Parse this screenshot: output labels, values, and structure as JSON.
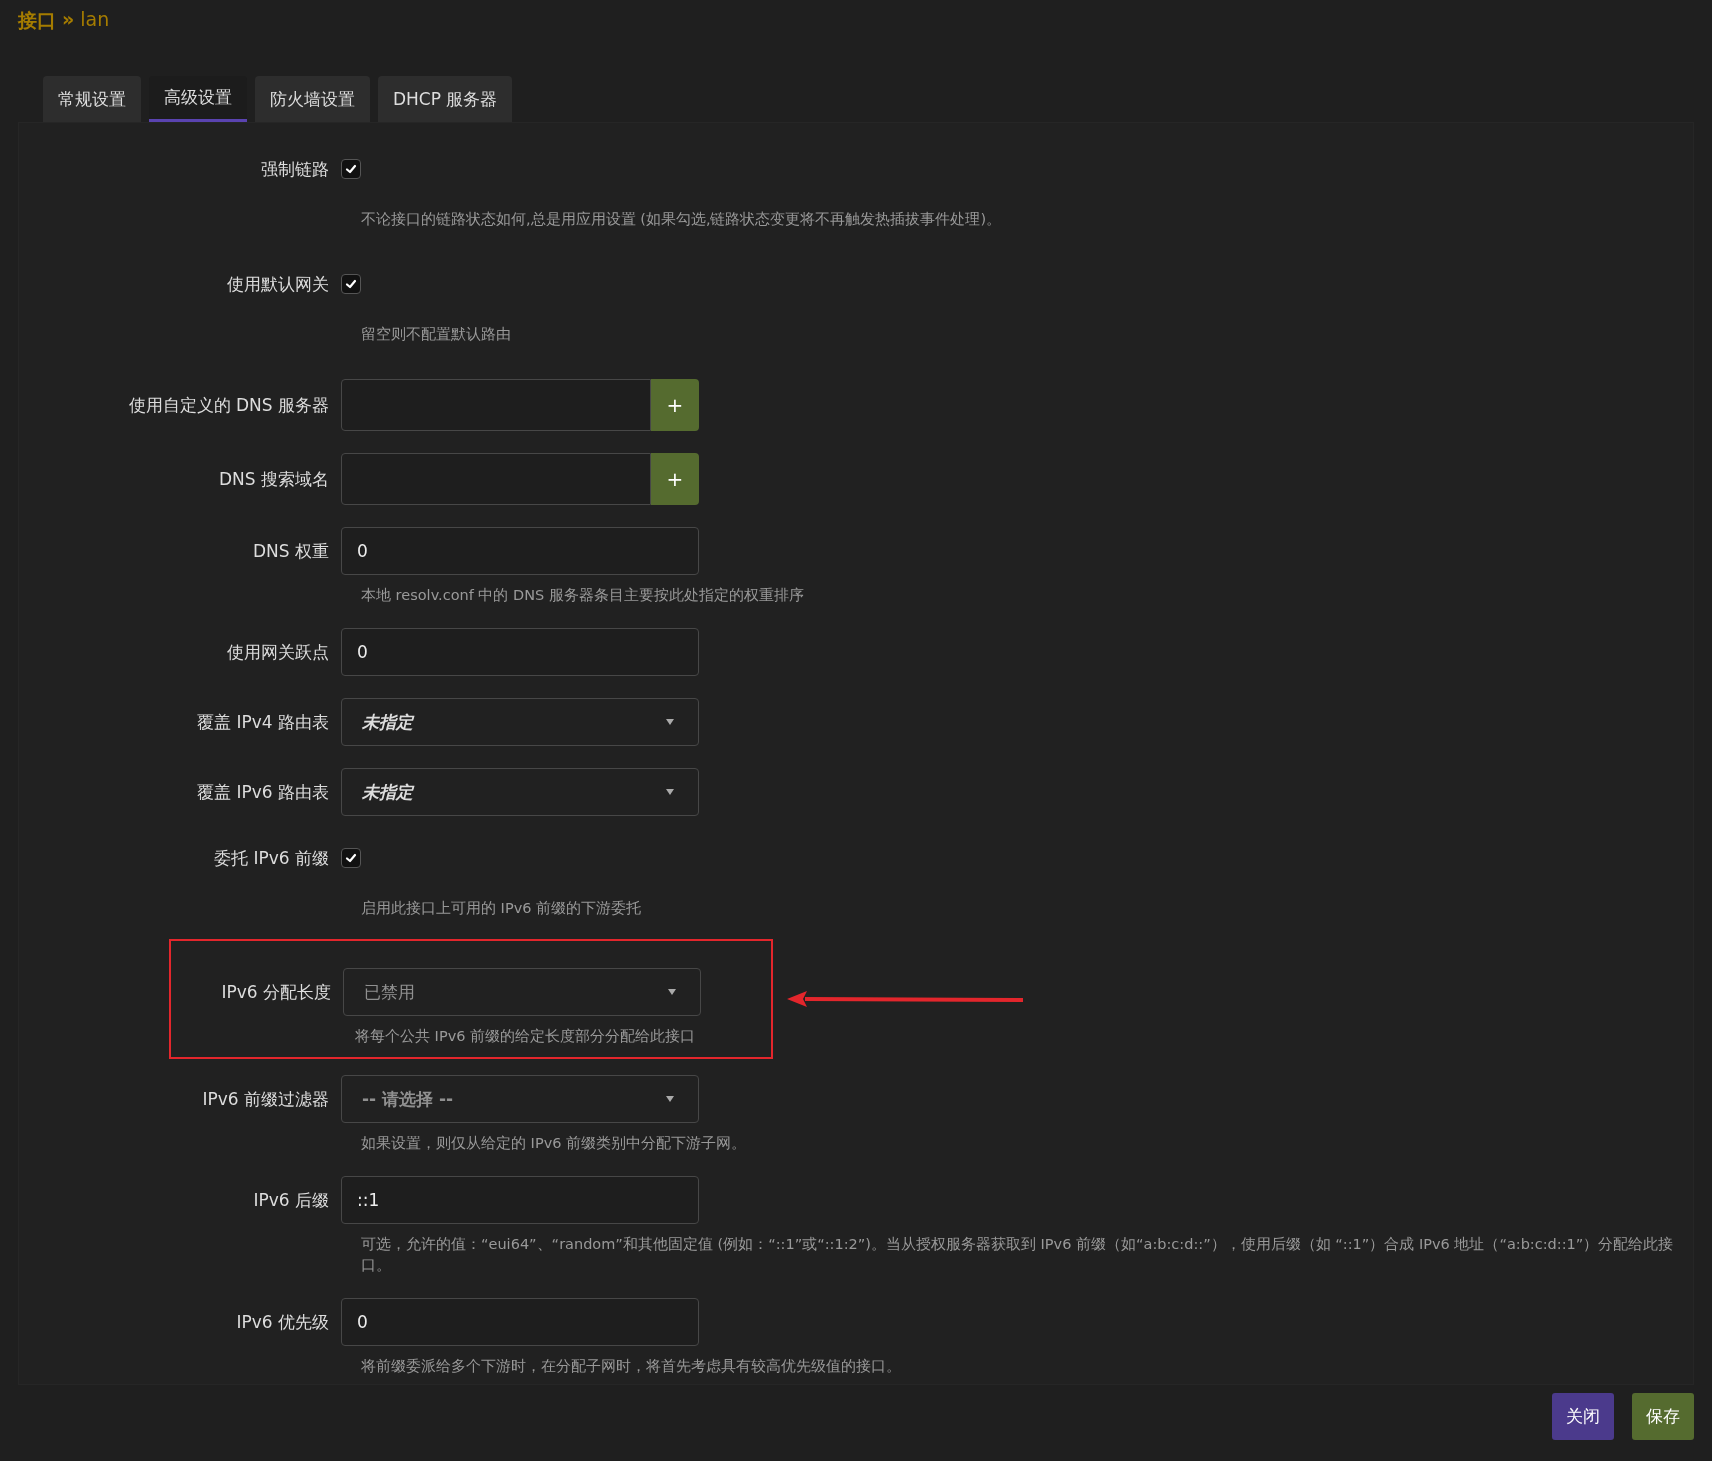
{
  "breadcrumb": {
    "parent": "接口",
    "separator": "»",
    "current": "lan"
  },
  "tabs": [
    {
      "label": "常规设置",
      "selected": false
    },
    {
      "label": "高级设置",
      "selected": true
    },
    {
      "label": "防火墙设置",
      "selected": false
    },
    {
      "label": "DHCP 服务器",
      "selected": false
    }
  ],
  "fields": [
    {
      "kind": "checkbox",
      "label": "强制链路",
      "checked": true,
      "help": "不论接口的链路状态如何,总是用应用设置 (如果勾选,链路状态变更将不再触发热插拔事件处理)。",
      "highlighted": false
    },
    {
      "kind": "checkbox",
      "label": "使用默认网关",
      "checked": true,
      "help": "留空则不配置默认路由",
      "highlighted": false
    },
    {
      "kind": "dynlist",
      "label": "使用自定义的 DNS 服务器",
      "add": "+",
      "highlighted": false
    },
    {
      "kind": "dynlist",
      "label": "DNS 搜索域名",
      "add": "+",
      "highlighted": false
    },
    {
      "kind": "text",
      "label": "DNS 权重",
      "value": "0",
      "help": "本地 resolv.conf 中的 DNS 服务器条目主要按此处指定的权重排序",
      "highlighted": false
    },
    {
      "kind": "text",
      "label": "使用网关跃点",
      "value": "0",
      "highlighted": false
    },
    {
      "kind": "select",
      "label": "覆盖 IPv4 路由表",
      "value": "未指定",
      "bold": true,
      "italic": true,
      "dimmed": false,
      "highlighted": false
    },
    {
      "kind": "select",
      "label": "覆盖 IPv6 路由表",
      "value": "未指定",
      "bold": true,
      "italic": true,
      "dimmed": false,
      "highlighted": false
    },
    {
      "kind": "checkbox",
      "label": "委托 IPv6 前缀",
      "checked": true,
      "help": "启用此接口上可用的 IPv6 前缀的下游委托",
      "highlighted": false
    },
    {
      "kind": "select",
      "label": "IPv6 分配长度",
      "value": "已禁用",
      "bold": false,
      "italic": false,
      "dimmed": true,
      "help": "将每个公共 IPv6 前缀的给定长度部分分配给此接口",
      "highlighted": true
    },
    {
      "kind": "select",
      "label": "IPv6 前缀过滤器",
      "value": "-- 请选择 --",
      "bold": true,
      "italic": false,
      "dimmed": true,
      "help": "如果设置，则仅从给定的 IPv6 前缀类别中分配下游子网。",
      "highlighted": false
    },
    {
      "kind": "text",
      "label": "IPv6 后缀",
      "value": "::1",
      "help": "可选，允许的值：“eui64”、“random”和其他固定值 (例如：“::1”或“::1:2”)。当从授权服务器获取到 IPv6 前缀（如“a:b:c:d::”），使用后缀（如 “::1”）合成 IPv6 地址（“a:b:c:d::1”）分配给此接口。",
      "highlighted": false
    },
    {
      "kind": "text",
      "label": "IPv6 优先级",
      "value": "0",
      "help": "将前缀委派给多个下游时，在分配子网时，将首先考虑具有较高优先级值的接口。",
      "highlighted": false
    }
  ],
  "buttons": [
    {
      "label": "关闭",
      "kind": "close"
    },
    {
      "label": "保存",
      "kind": "save"
    }
  ]
}
